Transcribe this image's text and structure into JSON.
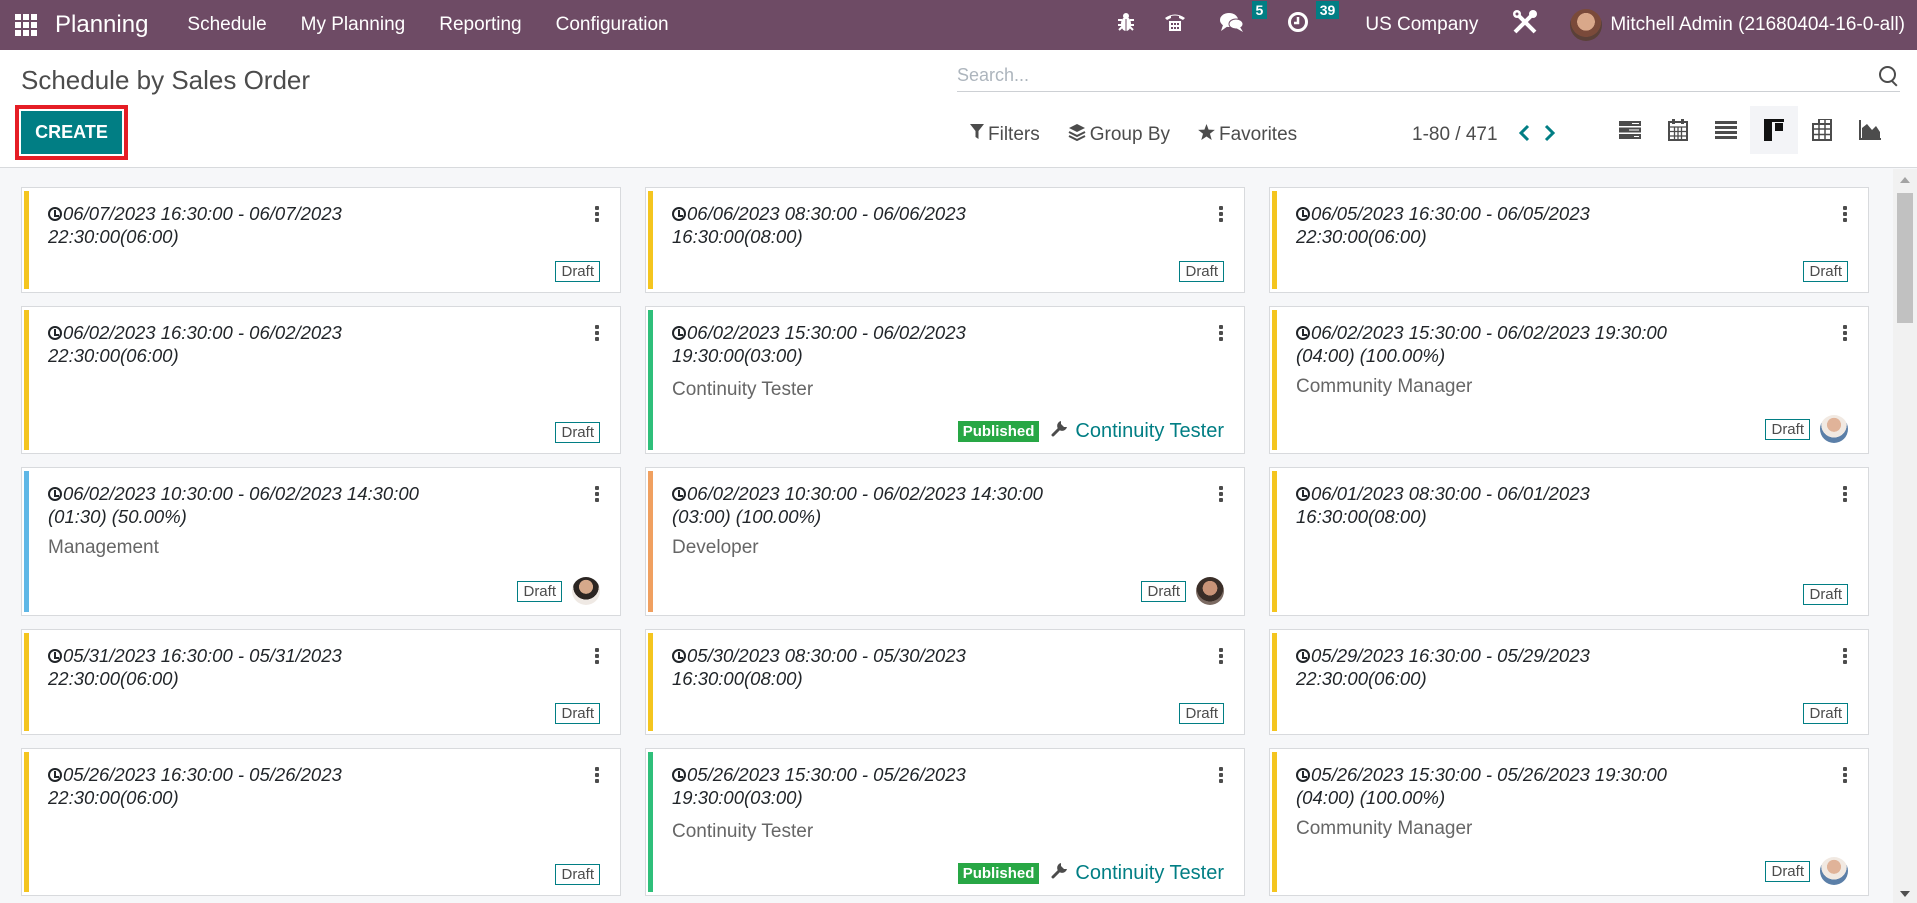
{
  "navbar": {
    "app_name": "Planning",
    "menu": [
      "Schedule",
      "My Planning",
      "Reporting",
      "Configuration"
    ],
    "messages_count": "5",
    "activities_count": "39",
    "company": "US Company",
    "user": "Mitchell Admin (21680404-16-0-all)"
  },
  "control_panel": {
    "title": "Schedule by Sales Order",
    "create_label": "CREATE",
    "search_placeholder": "Search...",
    "filters_label": "Filters",
    "groupby_label": "Group By",
    "favorites_label": "Favorites",
    "pager": "1-80 / 471",
    "views": [
      "gantt",
      "calendar",
      "list",
      "kanban",
      "pivot",
      "graph"
    ],
    "active_view": "kanban"
  },
  "colors": {
    "navbar": "#6e4b65",
    "primary": "#017e84",
    "draft_border": "#017e84",
    "published": "#28a745",
    "yellow": "#f4c51f",
    "green": "#2fbf7a",
    "blue": "#5fb7e6",
    "orange": "#f0a060",
    "highlight": "#e51d25"
  },
  "cards": [
    {
      "time": "06/07/2023 16:30:00 - 06/07/2023 22:30:00(06:00)",
      "role": "",
      "status": "Draft",
      "color": "#f4c51f"
    },
    {
      "time": "06/06/2023 08:30:00 - 06/06/2023 16:30:00(08:00)",
      "role": "",
      "status": "Draft",
      "color": "#f4c51f"
    },
    {
      "time": "06/05/2023 16:30:00 - 06/05/2023 22:30:00(06:00)",
      "role": "",
      "status": "Draft",
      "color": "#f4c51f"
    },
    {
      "time": "06/02/2023 16:30:00 - 06/02/2023 22:30:00(06:00)",
      "role": "",
      "status": "Draft",
      "color": "#f4c51f"
    },
    {
      "time": "06/02/2023 15:30:00 - 06/02/2023 19:30:00(03:00)",
      "role": "Continuity Tester",
      "status": "Published",
      "assignee": "Continuity Tester",
      "color": "#2fbf7a"
    },
    {
      "time": "06/02/2023 15:30:00 - 06/02/2023 19:30:00 (04:00) (100.00%)",
      "role": "Community Manager",
      "status": "Draft",
      "avatar": true,
      "color": "#f4c51f"
    },
    {
      "time": "06/02/2023 10:30:00 - 06/02/2023 14:30:00 (01:30) (50.00%)",
      "role": "Management",
      "status": "Draft",
      "avatar": true,
      "color": "#5fb7e6"
    },
    {
      "time": "06/02/2023 10:30:00 - 06/02/2023 14:30:00 (03:00) (100.00%)",
      "role": "Developer",
      "status": "Draft",
      "avatar": true,
      "color": "#f0a060"
    },
    {
      "time": "06/01/2023 08:30:00 - 06/01/2023 16:30:00(08:00)",
      "role": "",
      "status": "Draft",
      "color": "#f4c51f"
    },
    {
      "time": "05/31/2023 16:30:00 - 05/31/2023 22:30:00(06:00)",
      "role": "",
      "status": "Draft",
      "color": "#f4c51f"
    },
    {
      "time": "05/30/2023 08:30:00 - 05/30/2023 16:30:00(08:00)",
      "role": "",
      "status": "Draft",
      "color": "#f4c51f"
    },
    {
      "time": "05/29/2023 16:30:00 - 05/29/2023 22:30:00(06:00)",
      "role": "",
      "status": "Draft",
      "color": "#f4c51f"
    },
    {
      "time": "05/26/2023 16:30:00 - 05/26/2023 22:30:00(06:00)",
      "role": "",
      "status": "Draft",
      "color": "#f4c51f"
    },
    {
      "time": "05/26/2023 15:30:00 - 05/26/2023 19:30:00(03:00)",
      "role": "Continuity Tester",
      "status": "Published",
      "assignee": "Continuity Tester",
      "color": "#2fbf7a"
    },
    {
      "time": "05/26/2023 15:30:00 - 05/26/2023 19:30:00 (04:00) (100.00%)",
      "role": "Community Manager",
      "status": "Draft",
      "avatar": true,
      "color": "#f4c51f"
    }
  ]
}
